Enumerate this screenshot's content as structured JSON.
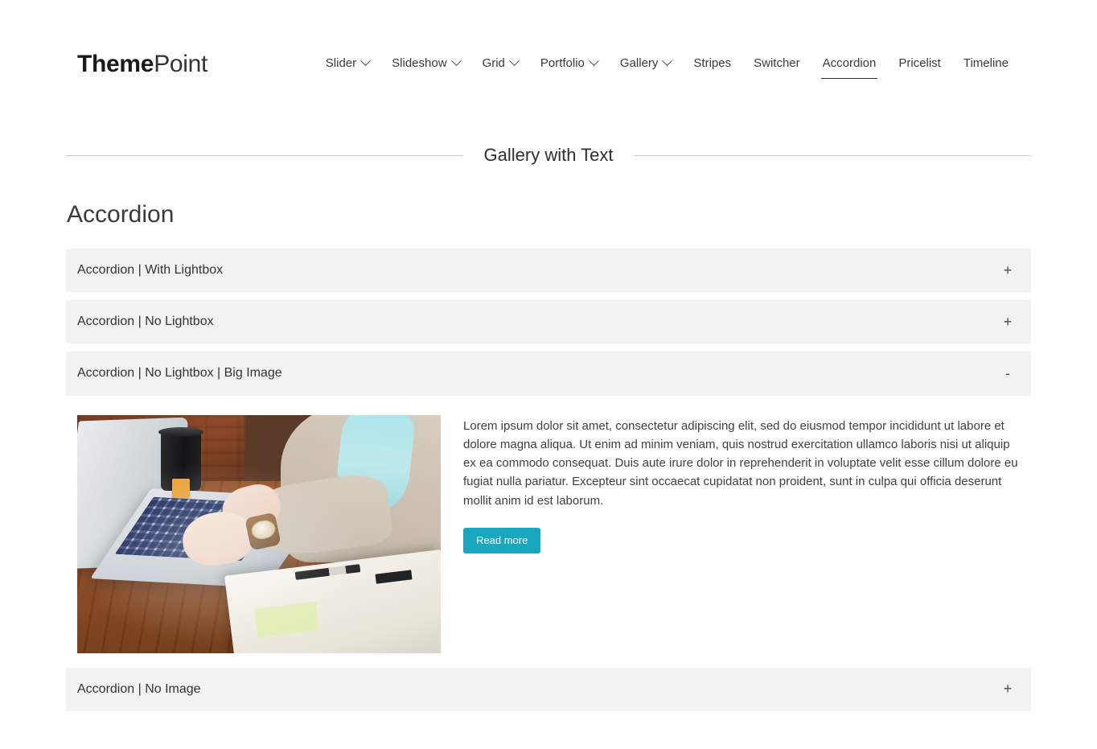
{
  "header": {
    "logo": {
      "bold": "Theme",
      "light": "Point"
    },
    "nav": [
      {
        "label": "Slider",
        "has_dropdown": true,
        "active": false
      },
      {
        "label": "Slideshow",
        "has_dropdown": true,
        "active": false
      },
      {
        "label": "Grid",
        "has_dropdown": true,
        "active": false
      },
      {
        "label": "Portfolio",
        "has_dropdown": true,
        "active": false
      },
      {
        "label": "Gallery",
        "has_dropdown": true,
        "active": false
      },
      {
        "label": "Stripes",
        "has_dropdown": false,
        "active": false
      },
      {
        "label": "Switcher",
        "has_dropdown": false,
        "active": false
      },
      {
        "label": "Accordion",
        "has_dropdown": false,
        "active": true
      },
      {
        "label": "Pricelist",
        "has_dropdown": false,
        "active": false
      },
      {
        "label": "Timeline",
        "has_dropdown": false,
        "active": false
      }
    ]
  },
  "section": {
    "title": "Gallery with Text"
  },
  "main": {
    "page_title": "Accordion",
    "accordion": [
      {
        "title": "Accordion | With Lightbox",
        "toggle": "+",
        "expanded": false
      },
      {
        "title": "Accordion | No Lightbox",
        "toggle": "+",
        "expanded": false
      },
      {
        "title": "Accordion | No Lightbox | Big Image",
        "toggle": "-",
        "expanded": true
      },
      {
        "title": "Accordion | No Image",
        "toggle": "+",
        "expanded": false
      }
    ],
    "panel": {
      "image_alt": "person typing on a laptop at a wooden desk with coffee cup and notebook",
      "text": "Lorem ipsum dolor sit amet, consectetur adipiscing elit, sed do eiusmod tempor incididunt ut labore et dolore magna aliqua. Ut enim ad minim veniam, quis nostrud exercitation ullamco laboris nisi ut aliquip ex ea commodo consequat. Duis aute irure dolor in reprehenderit in voluptate velit esse cillum dolore eu fugiat nulla pariatur. Excepteur sint occaecat cupidatat non proident, sunt in culpa qui officia deserunt mollit anim id est laborum.",
      "read_more_label": "Read more"
    }
  },
  "colors": {
    "accent": "#19a7c0",
    "accordion_header_bg": "#f2f2f2",
    "text": "#333333",
    "rule": "#c9c9c9"
  }
}
